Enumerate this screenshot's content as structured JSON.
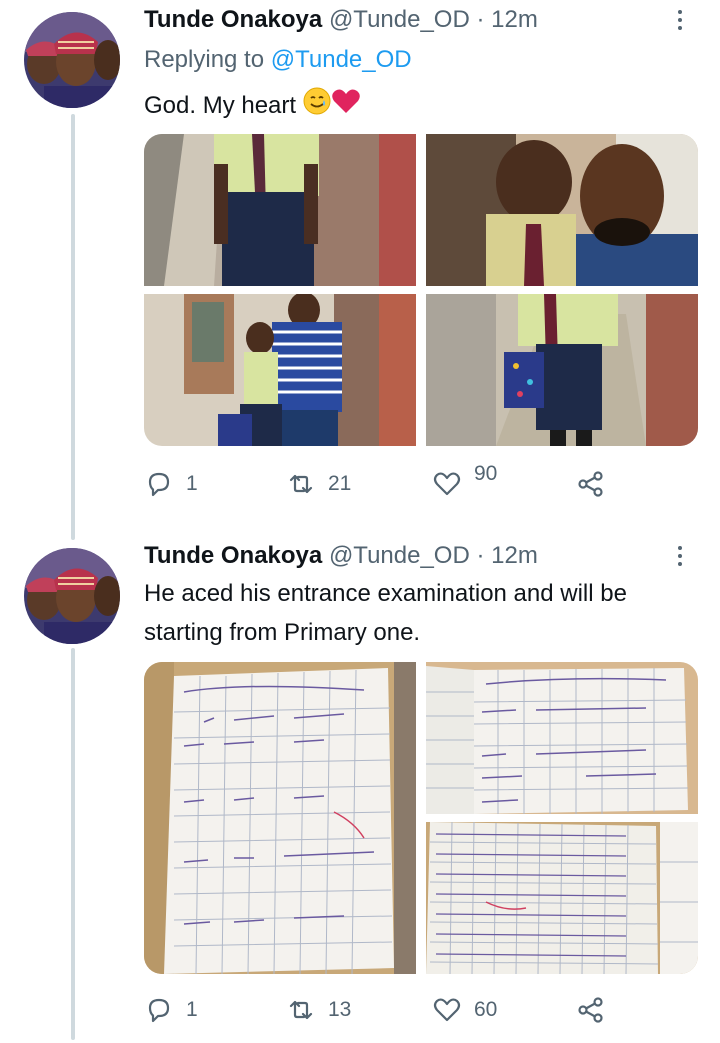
{
  "tweets": [
    {
      "name": "Tunde Onakoya",
      "handle": "@Tunde_OD",
      "separator": "·",
      "time": "12m",
      "reply_prefix": "Replying to",
      "reply_to": "@Tunde_OD",
      "text": "God. My heart",
      "emoji": [
        "smiling-face-with-tear",
        "red-heart"
      ],
      "media_description": [
        "boy in school uniform in alley",
        "boy and man selfie",
        "man with arm around boy",
        "boy with school bag in alley"
      ],
      "stats": {
        "replies": "1",
        "retweets": "21",
        "likes": "90"
      }
    },
    {
      "name": "Tunde Onakoya",
      "handle": "@Tunde_OD",
      "separator": "·",
      "time": "12m",
      "text": "He aced his entrance examination and will be starting from Primary one.",
      "media_description": [
        "handwritten addition worksheet",
        "handwritten spelling worksheet",
        "handwritten number grid"
      ],
      "stats": {
        "replies": "1",
        "retweets": "13",
        "likes": "60"
      }
    }
  ],
  "colors": {
    "text": "#0f1419",
    "secondary": "#536471",
    "link": "#1d9bf0",
    "thread_line": "#cfd9de"
  }
}
